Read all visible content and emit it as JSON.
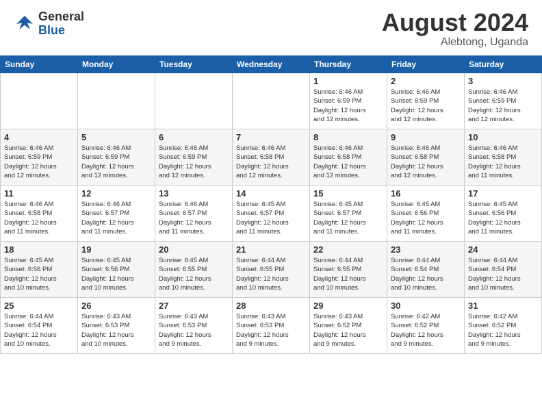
{
  "header": {
    "logo_general": "General",
    "logo_blue": "Blue",
    "month_year": "August 2024",
    "location": "Alebtong, Uganda"
  },
  "weekdays": [
    "Sunday",
    "Monday",
    "Tuesday",
    "Wednesday",
    "Thursday",
    "Friday",
    "Saturday"
  ],
  "weeks": [
    [
      {
        "day": "",
        "info": ""
      },
      {
        "day": "",
        "info": ""
      },
      {
        "day": "",
        "info": ""
      },
      {
        "day": "",
        "info": ""
      },
      {
        "day": "1",
        "info": "Sunrise: 6:46 AM\nSunset: 6:59 PM\nDaylight: 12 hours\nand 12 minutes."
      },
      {
        "day": "2",
        "info": "Sunrise: 6:46 AM\nSunset: 6:59 PM\nDaylight: 12 hours\nand 12 minutes."
      },
      {
        "day": "3",
        "info": "Sunrise: 6:46 AM\nSunset: 6:59 PM\nDaylight: 12 hours\nand 12 minutes."
      }
    ],
    [
      {
        "day": "4",
        "info": "Sunrise: 6:46 AM\nSunset: 6:59 PM\nDaylight: 12 hours\nand 12 minutes."
      },
      {
        "day": "5",
        "info": "Sunrise: 6:46 AM\nSunset: 6:59 PM\nDaylight: 12 hours\nand 12 minutes."
      },
      {
        "day": "6",
        "info": "Sunrise: 6:46 AM\nSunset: 6:59 PM\nDaylight: 12 hours\nand 12 minutes."
      },
      {
        "day": "7",
        "info": "Sunrise: 6:46 AM\nSunset: 6:58 PM\nDaylight: 12 hours\nand 12 minutes."
      },
      {
        "day": "8",
        "info": "Sunrise: 6:46 AM\nSunset: 6:58 PM\nDaylight: 12 hours\nand 12 minutes."
      },
      {
        "day": "9",
        "info": "Sunrise: 6:46 AM\nSunset: 6:58 PM\nDaylight: 12 hours\nand 12 minutes."
      },
      {
        "day": "10",
        "info": "Sunrise: 6:46 AM\nSunset: 6:58 PM\nDaylight: 12 hours\nand 11 minutes."
      }
    ],
    [
      {
        "day": "11",
        "info": "Sunrise: 6:46 AM\nSunset: 6:58 PM\nDaylight: 12 hours\nand 11 minutes."
      },
      {
        "day": "12",
        "info": "Sunrise: 6:46 AM\nSunset: 6:57 PM\nDaylight: 12 hours\nand 11 minutes."
      },
      {
        "day": "13",
        "info": "Sunrise: 6:46 AM\nSunset: 6:57 PM\nDaylight: 12 hours\nand 11 minutes."
      },
      {
        "day": "14",
        "info": "Sunrise: 6:45 AM\nSunset: 6:57 PM\nDaylight: 12 hours\nand 11 minutes."
      },
      {
        "day": "15",
        "info": "Sunrise: 6:45 AM\nSunset: 6:57 PM\nDaylight: 12 hours\nand 11 minutes."
      },
      {
        "day": "16",
        "info": "Sunrise: 6:45 AM\nSunset: 6:56 PM\nDaylight: 12 hours\nand 11 minutes."
      },
      {
        "day": "17",
        "info": "Sunrise: 6:45 AM\nSunset: 6:56 PM\nDaylight: 12 hours\nand 11 minutes."
      }
    ],
    [
      {
        "day": "18",
        "info": "Sunrise: 6:45 AM\nSunset: 6:56 PM\nDaylight: 12 hours\nand 10 minutes."
      },
      {
        "day": "19",
        "info": "Sunrise: 6:45 AM\nSunset: 6:56 PM\nDaylight: 12 hours\nand 10 minutes."
      },
      {
        "day": "20",
        "info": "Sunrise: 6:45 AM\nSunset: 6:55 PM\nDaylight: 12 hours\nand 10 minutes."
      },
      {
        "day": "21",
        "info": "Sunrise: 6:44 AM\nSunset: 6:55 PM\nDaylight: 12 hours\nand 10 minutes."
      },
      {
        "day": "22",
        "info": "Sunrise: 6:44 AM\nSunset: 6:55 PM\nDaylight: 12 hours\nand 10 minutes."
      },
      {
        "day": "23",
        "info": "Sunrise: 6:44 AM\nSunset: 6:54 PM\nDaylight: 12 hours\nand 10 minutes."
      },
      {
        "day": "24",
        "info": "Sunrise: 6:44 AM\nSunset: 6:54 PM\nDaylight: 12 hours\nand 10 minutes."
      }
    ],
    [
      {
        "day": "25",
        "info": "Sunrise: 6:44 AM\nSunset: 6:54 PM\nDaylight: 12 hours\nand 10 minutes."
      },
      {
        "day": "26",
        "info": "Sunrise: 6:43 AM\nSunset: 6:53 PM\nDaylight: 12 hours\nand 10 minutes."
      },
      {
        "day": "27",
        "info": "Sunrise: 6:43 AM\nSunset: 6:53 PM\nDaylight: 12 hours\nand 9 minutes."
      },
      {
        "day": "28",
        "info": "Sunrise: 6:43 AM\nSunset: 6:53 PM\nDaylight: 12 hours\nand 9 minutes."
      },
      {
        "day": "29",
        "info": "Sunrise: 6:43 AM\nSunset: 6:52 PM\nDaylight: 12 hours\nand 9 minutes."
      },
      {
        "day": "30",
        "info": "Sunrise: 6:42 AM\nSunset: 6:52 PM\nDaylight: 12 hours\nand 9 minutes."
      },
      {
        "day": "31",
        "info": "Sunrise: 6:42 AM\nSunset: 6:52 PM\nDaylight: 12 hours\nand 9 minutes."
      }
    ]
  ]
}
